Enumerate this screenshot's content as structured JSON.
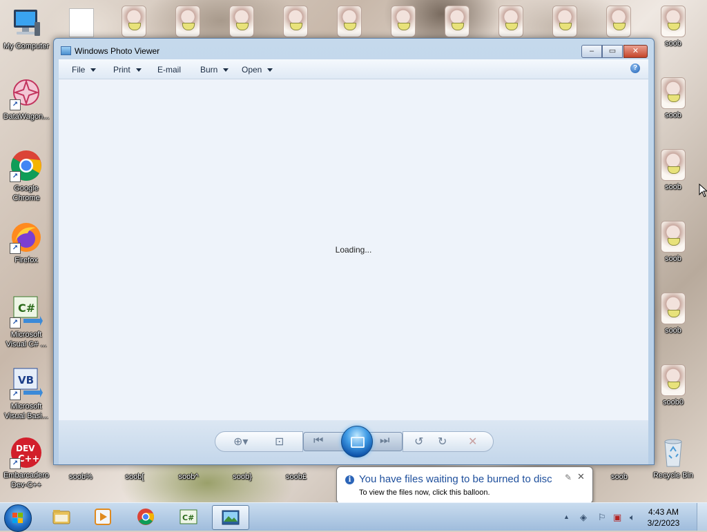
{
  "desktop": {
    "left_icons": [
      {
        "label": "My Computer"
      },
      {
        "label": "DataWagon..."
      },
      {
        "label": "Google Chrome"
      },
      {
        "label": "Firefox"
      },
      {
        "label": "Microsoft Visual C# ..."
      },
      {
        "label": "Microsoft Visual Basi..."
      },
      {
        "label": "Embarcadero Dev-C++"
      }
    ],
    "right_icons": [
      {
        "label": "soob"
      },
      {
        "label": "soob"
      },
      {
        "label": "soob"
      },
      {
        "label": "soob"
      },
      {
        "label": "soob"
      },
      {
        "label": "soob0"
      },
      {
        "label": "Recycle Bin"
      }
    ],
    "bottom_icons": [
      {
        "label": "soob%"
      },
      {
        "label": "soob["
      },
      {
        "label": "soob^"
      },
      {
        "label": "soob}"
      },
      {
        "label": "soob£"
      },
      {
        "label": "soob"
      }
    ]
  },
  "window": {
    "title": "Windows Photo Viewer",
    "menu": [
      {
        "label": "File",
        "has_dropdown": true
      },
      {
        "label": "Print",
        "has_dropdown": true
      },
      {
        "label": "E-mail",
        "has_dropdown": false
      },
      {
        "label": "Burn",
        "has_dropdown": true
      },
      {
        "label": "Open",
        "has_dropdown": true
      }
    ],
    "help_glyph": "?",
    "status_text": "Loading...",
    "caption": {
      "minimize": "–",
      "maximize": "▭",
      "close": "✕"
    },
    "controls": {
      "zoom": "⊕▾",
      "actual_size": "⊡",
      "previous": "⏮",
      "next": "⏭",
      "rotate_ccw": "↺",
      "rotate_cw": "↻",
      "delete": "✕"
    }
  },
  "balloon": {
    "title": "You have files waiting to be burned to disc",
    "body": "To view the files now, click this balloon.",
    "info_glyph": "i",
    "close_glyph": "✕"
  },
  "taskbar": {
    "tray_expand": "▲",
    "clock_time": "4:43 AM",
    "clock_date": "3/2/2023",
    "apps": [
      "windows-explorer",
      "media-player",
      "google-chrome",
      "visual-csharp",
      "photo-viewer"
    ],
    "active_app": "photo-viewer"
  },
  "colors": {
    "accent": "#1e4f9c",
    "close_button": "#c5452a",
    "taskbar": "#9fbcdc"
  }
}
